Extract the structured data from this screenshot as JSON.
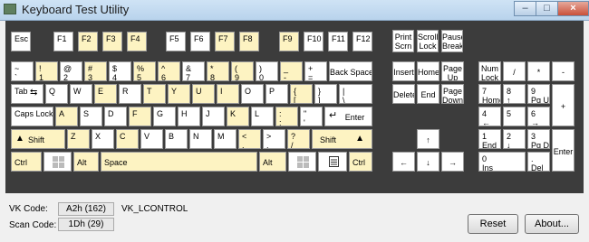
{
  "window": {
    "title": "Keyboard Test Utility",
    "min_glyph": "–",
    "max_glyph": "□",
    "close_glyph": "×"
  },
  "keys": {
    "esc": {
      "l1": "Esc"
    },
    "f1": {
      "l1": "F1"
    },
    "f2": {
      "l1": "F2"
    },
    "f3": {
      "l1": "F3"
    },
    "f4": {
      "l1": "F4"
    },
    "f5": {
      "l1": "F5"
    },
    "f6": {
      "l1": "F6"
    },
    "f7": {
      "l1": "F7"
    },
    "f8": {
      "l1": "F8"
    },
    "f9": {
      "l1": "F9"
    },
    "f10": {
      "l1": "F10"
    },
    "f11": {
      "l1": "F11"
    },
    "f12": {
      "l1": "F12"
    },
    "print": {
      "l1": "Print",
      "l2": "Scrn"
    },
    "scroll": {
      "l1": "Scroll",
      "l2": "Lock"
    },
    "pause": {
      "l1": "Pause",
      "l2": "Break"
    },
    "tilde": {
      "l1": "~",
      "l2": "`"
    },
    "d1": {
      "l1": "!",
      "l2": "1"
    },
    "d2": {
      "l1": "@",
      "l2": "2"
    },
    "d3": {
      "l1": "#",
      "l2": "3"
    },
    "d4": {
      "l1": "$",
      "l2": "4"
    },
    "d5": {
      "l1": "%",
      "l2": "5"
    },
    "d6": {
      "l1": "^",
      "l2": "6"
    },
    "d7": {
      "l1": "&",
      "l2": "7"
    },
    "d8": {
      "l1": "*",
      "l2": "8"
    },
    "d9": {
      "l1": "(",
      "l2": "9"
    },
    "d0": {
      "l1": ")",
      "l2": "0"
    },
    "minus": {
      "l1": "_",
      "l2": "-"
    },
    "equals": {
      "l1": "+",
      "l2": "="
    },
    "backspace": {
      "l1": "Back Space"
    },
    "insert": {
      "l1": "Insert"
    },
    "home": {
      "l1": "Home"
    },
    "pageup": {
      "l1": "Page",
      "l2": "Up"
    },
    "numlock": {
      "l1": "Num",
      "l2": "Lock"
    },
    "np_div": {
      "l1": "/"
    },
    "np_mul": {
      "l1": "*"
    },
    "np_sub": {
      "l1": "-"
    },
    "tab": {
      "l1": "Tab"
    },
    "q": {
      "l1": "Q"
    },
    "w": {
      "l1": "W"
    },
    "e": {
      "l1": "E"
    },
    "r": {
      "l1": "R"
    },
    "t": {
      "l1": "T"
    },
    "y": {
      "l1": "Y"
    },
    "u": {
      "l1": "U"
    },
    "i": {
      "l1": "I"
    },
    "o": {
      "l1": "O"
    },
    "p": {
      "l1": "P"
    },
    "lbracket": {
      "l1": "{",
      "l2": "["
    },
    "rbracket": {
      "l1": "}",
      "l2": "]"
    },
    "backslash": {
      "l1": "|",
      "l2": "\\"
    },
    "delete": {
      "l1": "Delete"
    },
    "end": {
      "l1": "End"
    },
    "pagedown": {
      "l1": "Page",
      "l2": "Down"
    },
    "np7": {
      "l1": "7",
      "l2": "Home"
    },
    "np8": {
      "l1": "8",
      "l2": "↑"
    },
    "np9": {
      "l1": "9",
      "l2": "Pg Up"
    },
    "np_add": {
      "l1": "+"
    },
    "caps": {
      "l1": "Caps Lock"
    },
    "a": {
      "l1": "A"
    },
    "s": {
      "l1": "S"
    },
    "d": {
      "l1": "D"
    },
    "f": {
      "l1": "F"
    },
    "g": {
      "l1": "G"
    },
    "h": {
      "l1": "H"
    },
    "j": {
      "l1": "J"
    },
    "k": {
      "l1": "K"
    },
    "l": {
      "l1": "L"
    },
    "semicolon": {
      "l1": ":",
      "l2": ";"
    },
    "quote": {
      "l1": "\"",
      "l2": "'"
    },
    "enter": {
      "l1": "Enter"
    },
    "np4": {
      "l1": "4",
      "l2": "←"
    },
    "np5": {
      "l1": "5"
    },
    "np6": {
      "l1": "6",
      "l2": "→"
    },
    "lshift": {
      "l1": "Shift"
    },
    "z": {
      "l1": "Z"
    },
    "x": {
      "l1": "X"
    },
    "c": {
      "l1": "C"
    },
    "v": {
      "l1": "V"
    },
    "b": {
      "l1": "B"
    },
    "n": {
      "l1": "N"
    },
    "m": {
      "l1": "M"
    },
    "comma": {
      "l1": "<",
      "l2": ","
    },
    "period": {
      "l1": ">",
      "l2": "."
    },
    "slash": {
      "l1": "?",
      "l2": "/"
    },
    "rshift": {
      "l1": "Shift"
    },
    "up": {
      "l1": "↑"
    },
    "np1": {
      "l1": "1",
      "l2": "End"
    },
    "np2": {
      "l1": "2",
      "l2": "↓"
    },
    "np3": {
      "l1": "3",
      "l2": "Pg Dn"
    },
    "np_enter": {
      "l1": "Enter"
    },
    "lctrl": {
      "l1": "Ctrl"
    },
    "lalt": {
      "l1": "Alt"
    },
    "space": {
      "l1": "Space"
    },
    "ralt": {
      "l1": "Alt"
    },
    "rctrl": {
      "l1": "Ctrl"
    },
    "left": {
      "l1": "←"
    },
    "down": {
      "l1": "↓"
    },
    "right": {
      "l1": "→"
    },
    "np0": {
      "l1": "0",
      "l2": "Ins"
    },
    "np_dot": {
      "l1": ".",
      "l2": "Del"
    }
  },
  "highlight_color": "#fdf3c2",
  "status": {
    "vk_label": "VK Code:",
    "vk_value": "A2h (162)",
    "vk_name": "VK_LCONTROL",
    "scan_label": "Scan Code:",
    "scan_value": "1Dh (29)"
  },
  "buttons": {
    "reset": "Reset",
    "about": "About..."
  }
}
